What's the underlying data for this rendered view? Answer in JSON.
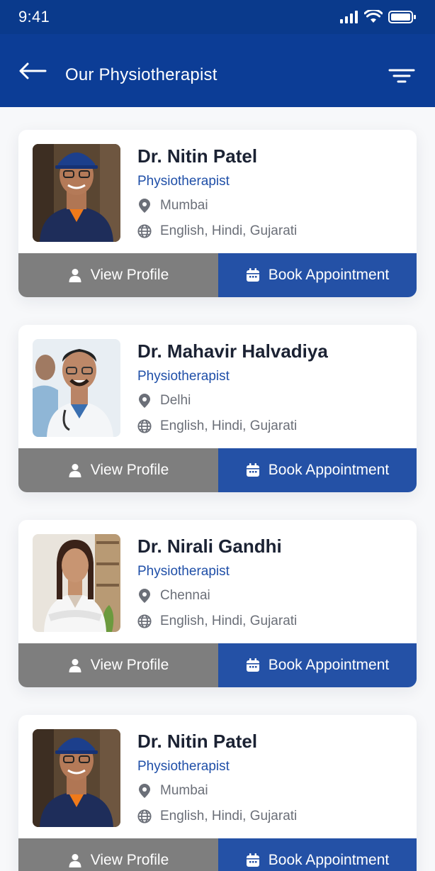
{
  "status_bar": {
    "time": "9:41"
  },
  "header": {
    "title": "Our Physiotherapist"
  },
  "colors": {
    "primary": "#0c3d96",
    "accent": "#2451a6",
    "view_button": "#7e7e7e"
  },
  "doctors": [
    {
      "name": "Dr. Nitin Patel",
      "role": "Physiotherapist",
      "city": "Mumbai",
      "languages": "English, Hindi, Gujarati",
      "view_label": "View Profile",
      "book_label": "Book Appointment"
    },
    {
      "name": "Dr. Mahavir Halvadiya",
      "role": "Physiotherapist",
      "city": "Delhi",
      "languages": "English, Hindi, Gujarati",
      "view_label": "View Profile",
      "book_label": "Book Appointment"
    },
    {
      "name": "Dr. Nirali Gandhi",
      "role": "Physiotherapist",
      "city": "Chennai",
      "languages": "English, Hindi, Gujarati",
      "view_label": "View Profile",
      "book_label": "Book Appointment"
    },
    {
      "name": "Dr. Nitin Patel",
      "role": "Physiotherapist",
      "city": "Mumbai",
      "languages": "English, Hindi, Gujarati",
      "view_label": "View Profile",
      "book_label": "Book Appointment"
    }
  ]
}
